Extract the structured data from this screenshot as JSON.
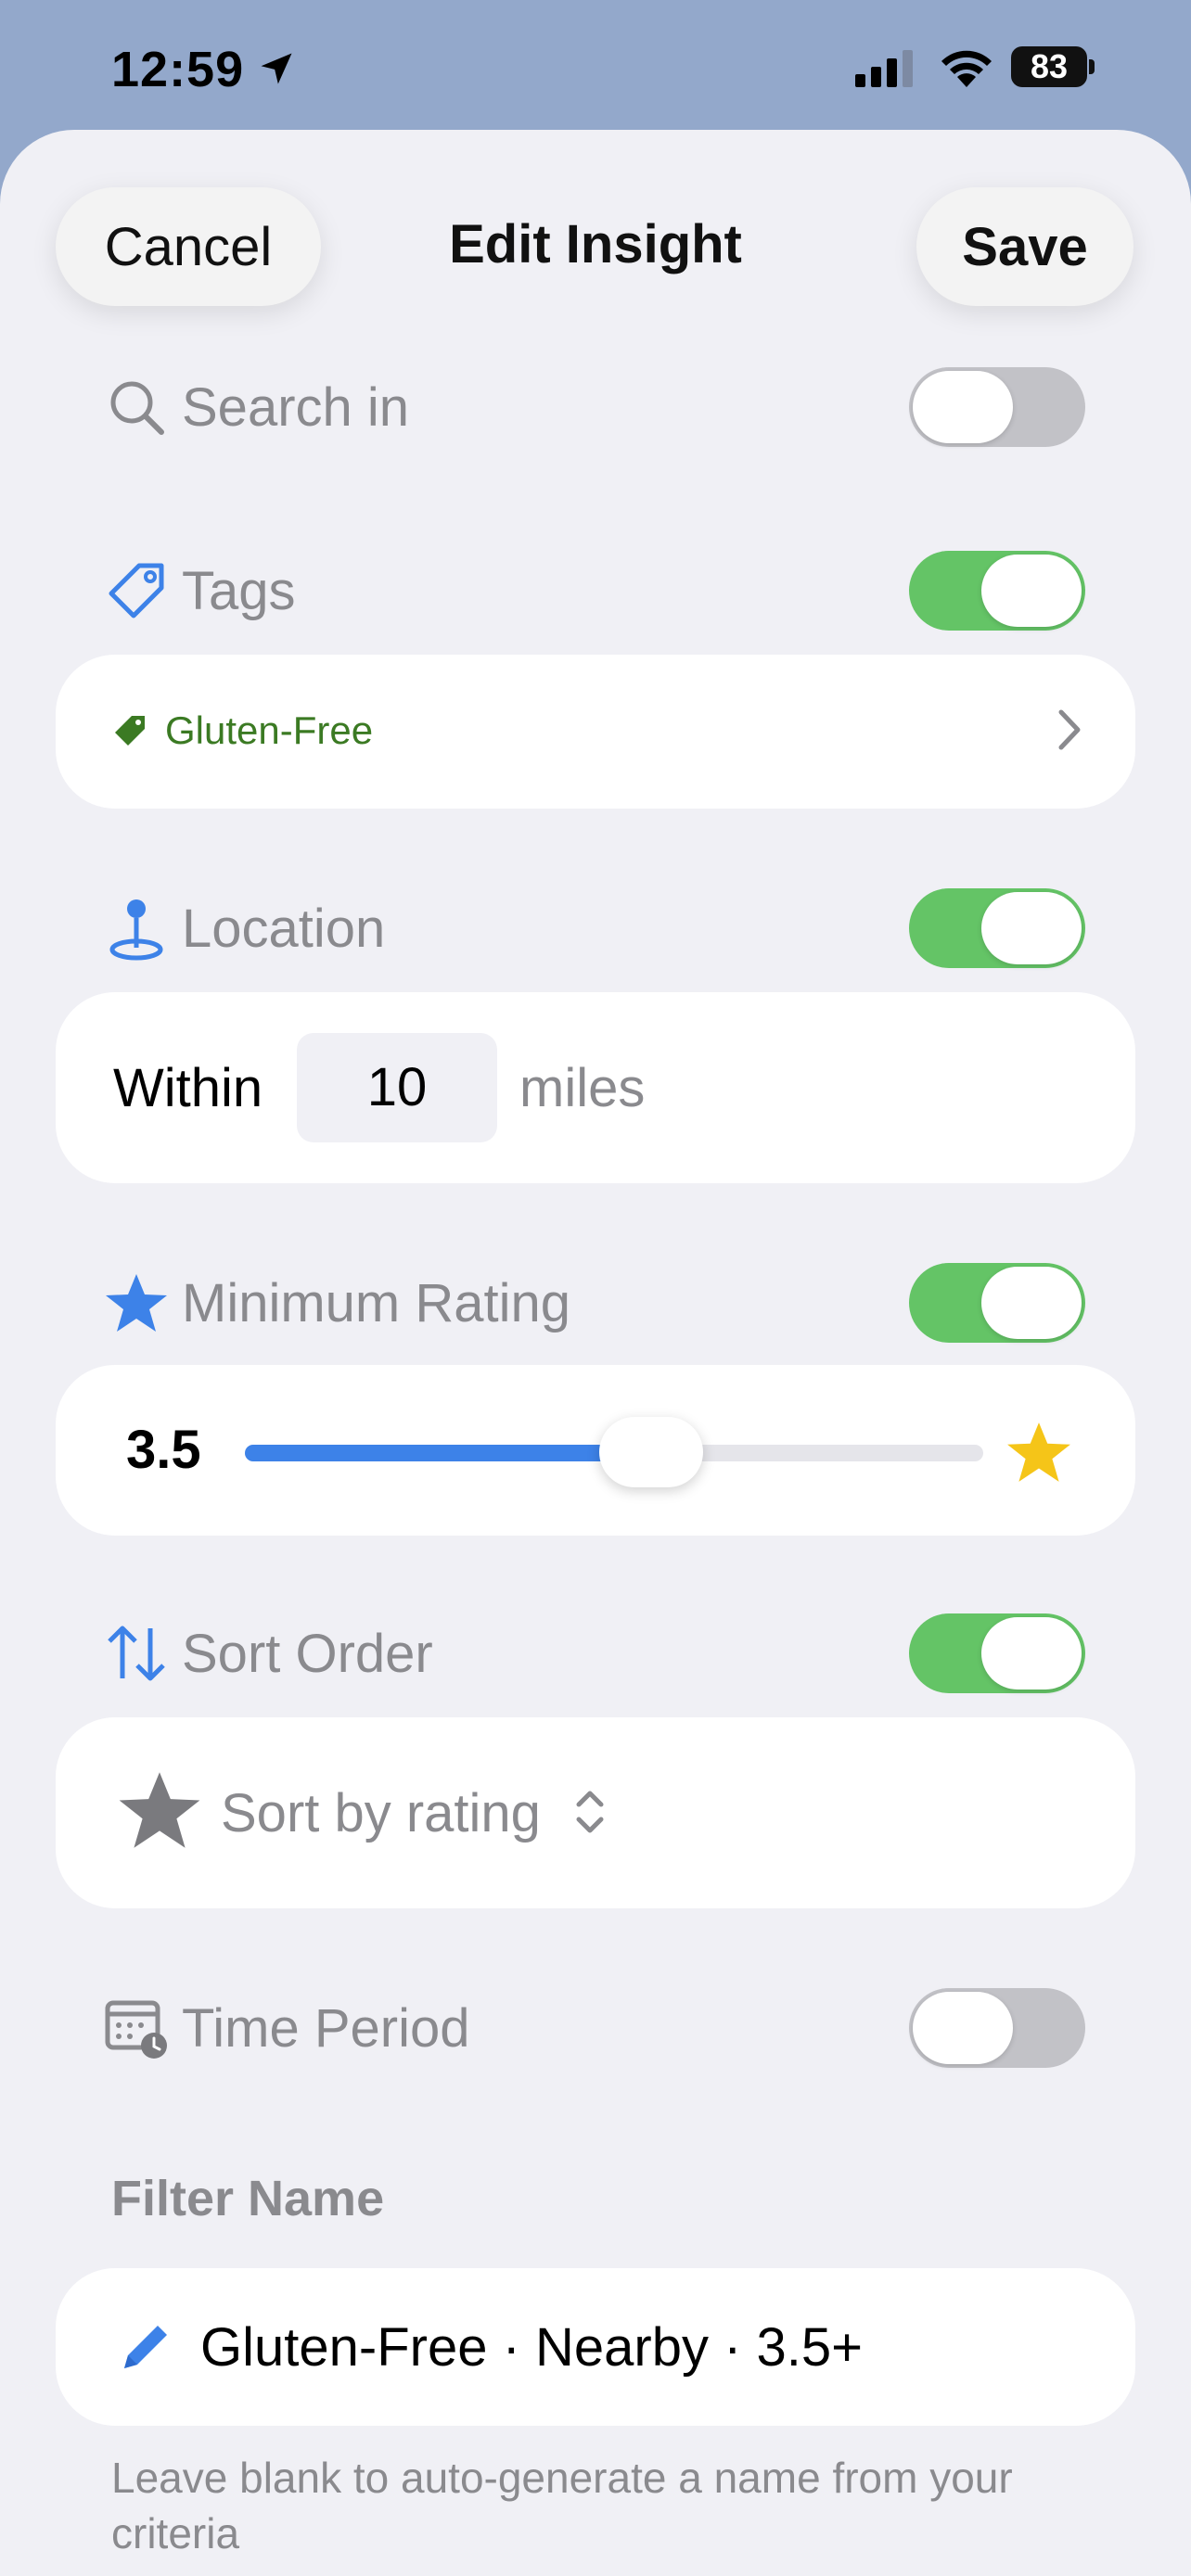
{
  "status_bar": {
    "time": "12:59",
    "battery": "83"
  },
  "nav": {
    "cancel": "Cancel",
    "title": "Edit Insight",
    "save": "Save"
  },
  "sections": {
    "search_in": {
      "label": "Search in",
      "enabled": false
    },
    "tags": {
      "label": "Tags",
      "enabled": true,
      "selected_tag": "Gluten-Free"
    },
    "location": {
      "label": "Location",
      "enabled": true,
      "prefix": "Within",
      "distance": "10",
      "unit": "miles"
    },
    "minimum_rating": {
      "label": "Minimum Rating",
      "enabled": true,
      "value": "3.5",
      "slider_fraction": 0.55
    },
    "sort_order": {
      "label": "Sort Order",
      "enabled": true,
      "option": "Sort by rating"
    },
    "time_period": {
      "label": "Time Period",
      "enabled": false
    }
  },
  "filter_name": {
    "heading": "Filter Name",
    "value": "Gluten-Free · Nearby · 3.5+",
    "hint": "Leave blank to auto-generate a name from your criteria"
  },
  "colors": {
    "accent": "#3d82e8",
    "toggle_on": "#64c466",
    "tag_green": "#3b7a23",
    "star_yellow": "#f5c518"
  }
}
